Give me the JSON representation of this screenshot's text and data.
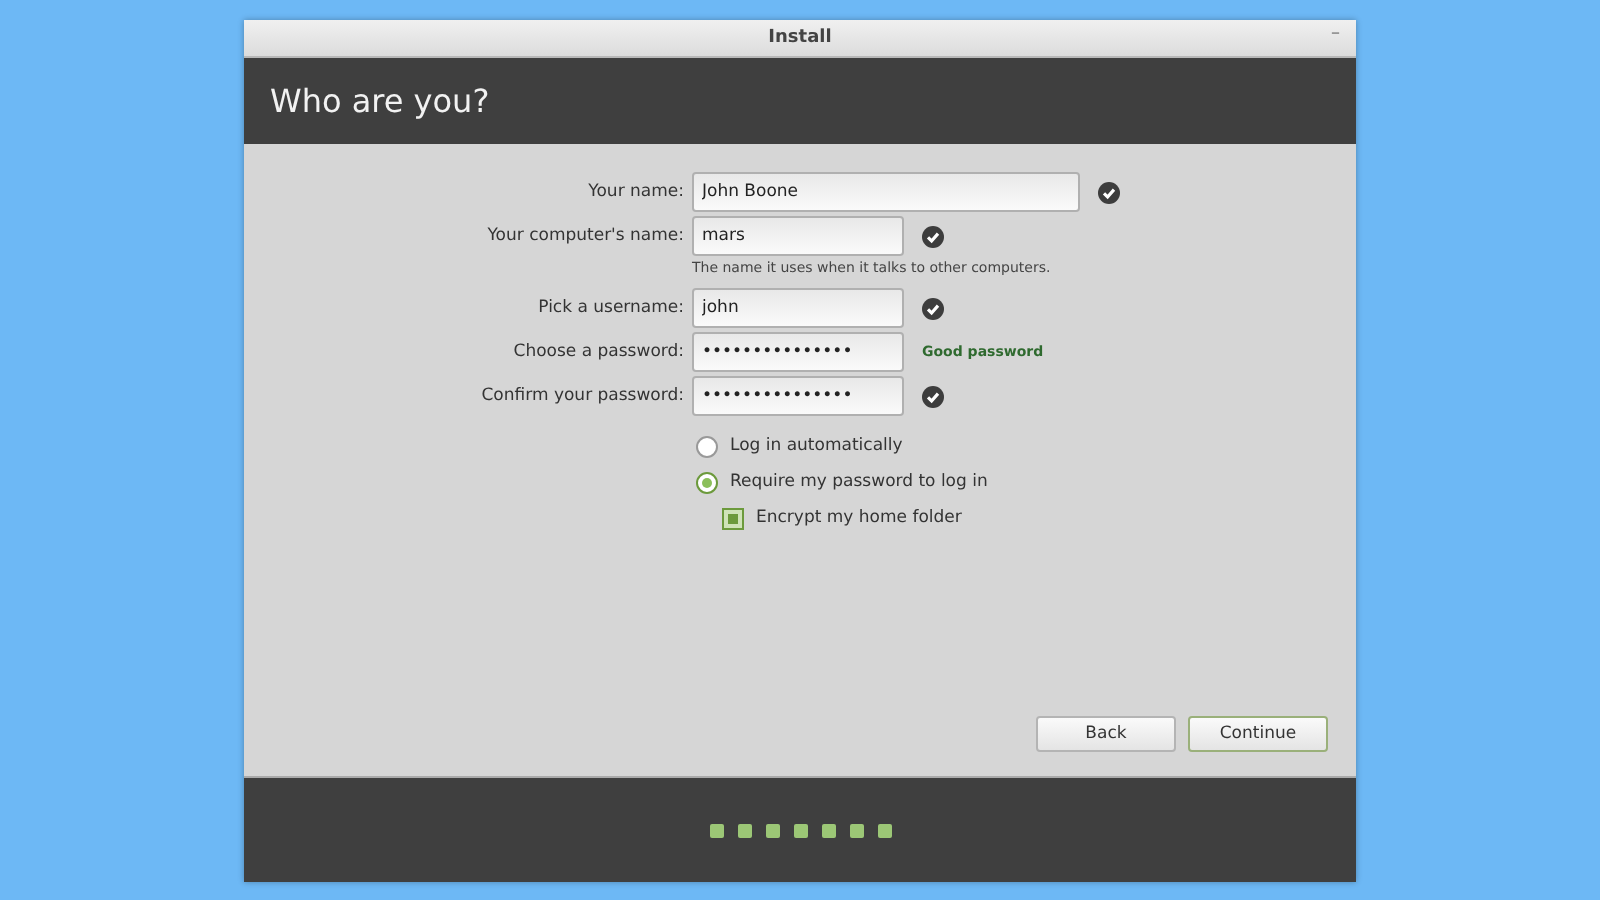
{
  "window": {
    "title": "Install",
    "minimize": "–"
  },
  "header": {
    "title": "Who are you?"
  },
  "fields": [
    {
      "label": "Your name:",
      "value": "John Boone",
      "wide": true,
      "valid": true
    },
    {
      "label": "Your computer's name:",
      "value": "mars",
      "wide": false,
      "valid": true,
      "hint": "The name it uses when it talks to other computers."
    },
    {
      "label": "Pick a username:",
      "value": "john",
      "wide": false,
      "valid": true
    },
    {
      "label": "Choose a password:",
      "value": "•••••••••••••••",
      "wide": false,
      "valid": false,
      "strength": "Good password"
    },
    {
      "label": "Confirm your password:",
      "value": "•••••••••••••••",
      "wide": false,
      "valid": true
    }
  ],
  "login_options": [
    {
      "label": "Log in automatically",
      "selected": false
    },
    {
      "label": "Require my password to log in",
      "selected": true
    }
  ],
  "encrypt": {
    "label": "Encrypt my home folder",
    "checked": true
  },
  "buttons": [
    {
      "label": "Back",
      "primary": false
    },
    {
      "label": "Continue",
      "primary": true
    }
  ],
  "progress_steps": [
    {
      "done": true
    },
    {
      "done": true
    },
    {
      "done": true
    },
    {
      "done": true
    },
    {
      "done": true
    },
    {
      "done": true
    },
    {
      "done": true
    }
  ]
}
